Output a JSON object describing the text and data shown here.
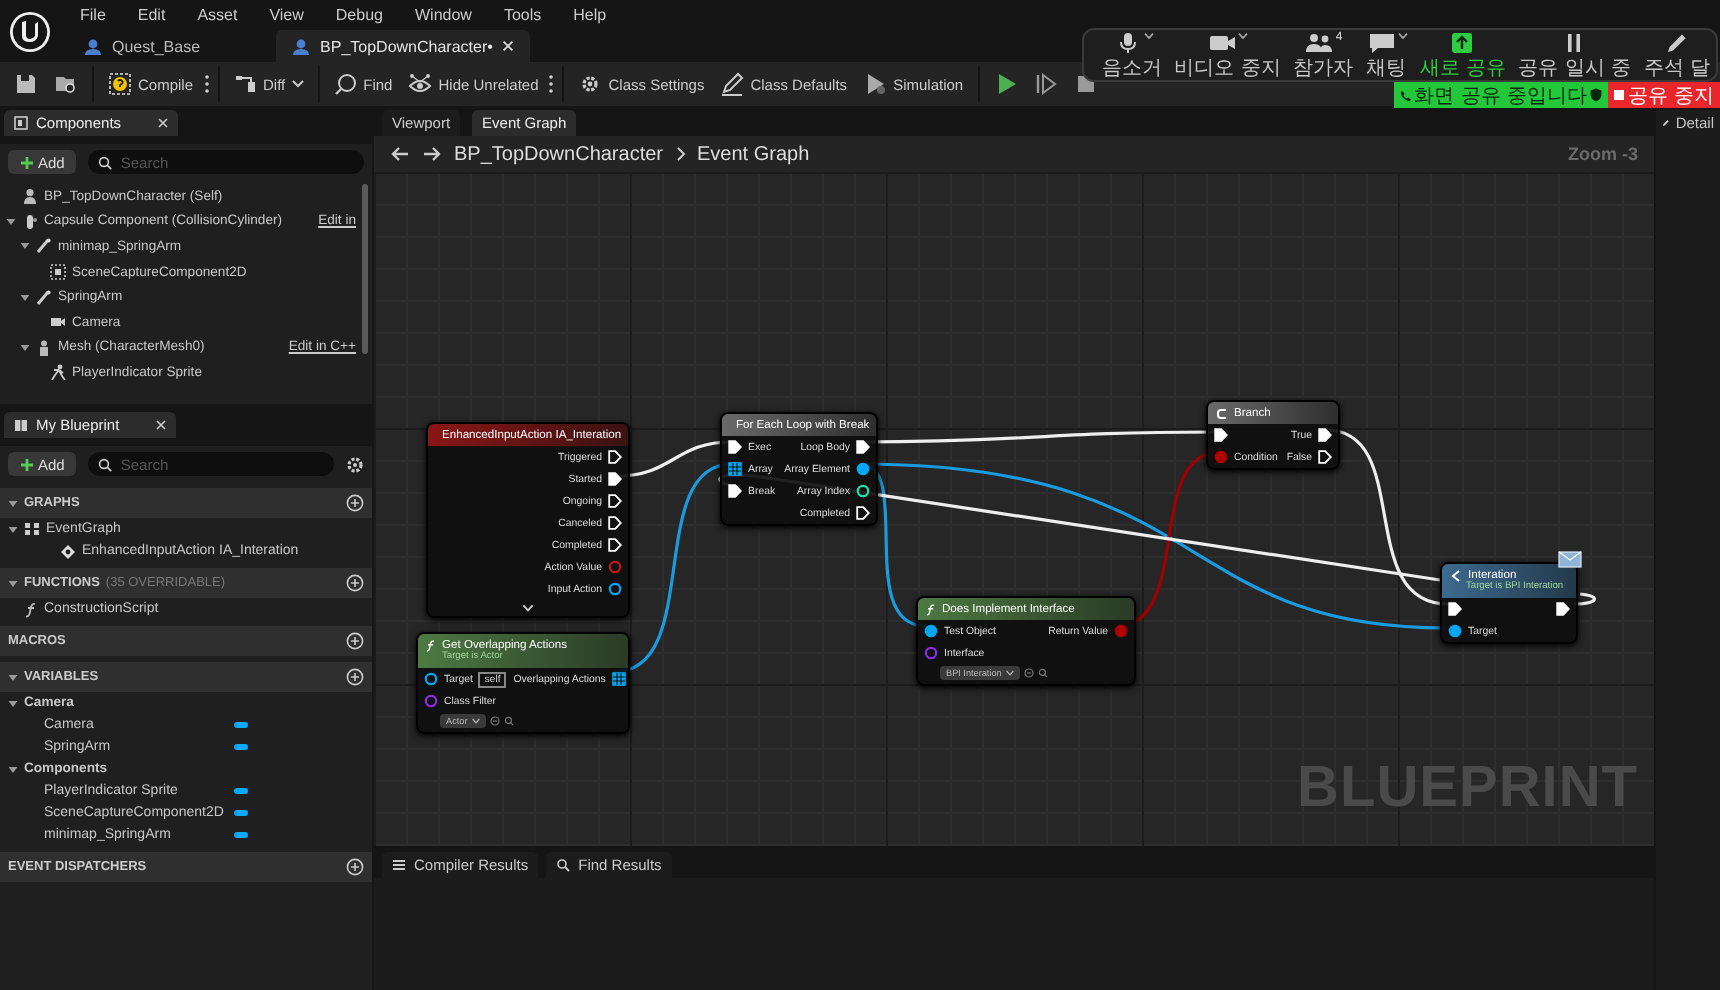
{
  "menu": [
    "File",
    "Edit",
    "Asset",
    "View",
    "Debug",
    "Window",
    "Tools",
    "Help"
  ],
  "document_tabs": [
    {
      "label": "Quest_Base",
      "selected": false
    },
    {
      "label": "BP_TopDownCharacter•",
      "selected": true
    }
  ],
  "toolbar": [
    {
      "kind": "save"
    },
    {
      "kind": "browse"
    },
    {
      "kind": "compile",
      "label": "Compile"
    },
    {
      "kind": "diff",
      "label": "Diff"
    },
    {
      "kind": "find",
      "label": "Find"
    },
    {
      "kind": "hide",
      "label": "Hide Unrelated"
    },
    {
      "kind": "class_settings",
      "label": "Class Settings"
    },
    {
      "kind": "class_defaults",
      "label": "Class Defaults"
    },
    {
      "kind": "simulation",
      "label": "Simulation"
    },
    {
      "kind": "play"
    },
    {
      "kind": "step"
    },
    {
      "kind": "stop"
    }
  ],
  "meeting_controls": [
    {
      "kind": "mic",
      "label": "음소거",
      "menu": true
    },
    {
      "kind": "video",
      "label": "비디오 중지",
      "menu": true
    },
    {
      "kind": "participants",
      "label": "참가자",
      "menu": false,
      "count": "4"
    },
    {
      "kind": "chat",
      "label": "채팅",
      "menu": true
    },
    {
      "kind": "share",
      "label": "새로 공유",
      "menu": false
    },
    {
      "kind": "pause",
      "label": "공유 일시 중",
      "menu": false
    },
    {
      "kind": "annotate",
      "label": "주석 달",
      "menu": false
    }
  ],
  "sharing_banner": {
    "message": "화면 공유 중입니다",
    "stop": "공유 중지"
  },
  "components": {
    "tab": "Components",
    "add": "Add",
    "search_placeholder": "Search",
    "tree": [
      {
        "label": "BP_TopDownCharacter (Self)",
        "kind": "actor"
      },
      {
        "label": "Capsule Component (CollisionCylinder)",
        "kind": "capsule",
        "edit_link": "Edit in",
        "children": [
          {
            "label": "minimap_SpringArm",
            "kind": "spring_arm",
            "children": [
              {
                "label": "SceneCaptureComponent2D",
                "kind": "scene_capture"
              }
            ]
          },
          {
            "label": "SpringArm",
            "kind": "spring_arm",
            "children": [
              {
                "label": "Camera",
                "kind": "camera"
              }
            ]
          },
          {
            "label": "Mesh (CharacterMesh0)",
            "kind": "mesh",
            "edit_link": "Edit in C++",
            "children": [
              {
                "label": "PlayerIndicator Sprite",
                "kind": "sprite"
              }
            ]
          }
        ]
      }
    ]
  },
  "my_blueprint": {
    "tab": "My Blueprint",
    "add": "Add",
    "search_placeholder": "Search",
    "sections": [
      {
        "title": "GRAPHS",
        "items": [
          {
            "label": "EventGraph",
            "kind": "graph",
            "children": [
              {
                "label": "EnhancedInputAction IA_Interation",
                "kind": "event"
              }
            ]
          }
        ]
      },
      {
        "title": "FUNCTIONS",
        "note": "(35 OVERRIDABLE)",
        "items": [
          {
            "label": "ConstructionScript",
            "kind": "function"
          }
        ]
      },
      {
        "title": "MACROS"
      },
      {
        "title": "VARIABLES",
        "items": [
          {
            "label": "Camera",
            "kind": "category",
            "children": [
              {
                "label": "Camera",
                "kind": "variable"
              },
              {
                "label": "SpringArm",
                "kind": "variable"
              }
            ]
          },
          {
            "label": "Components",
            "kind": "category",
            "children": [
              {
                "label": "PlayerIndicator Sprite",
                "kind": "variable"
              },
              {
                "label": "SceneCaptureComponent2D",
                "kind": "variable"
              },
              {
                "label": "minimap_SpringArm",
                "kind": "variable"
              }
            ]
          }
        ]
      },
      {
        "title": "EVENT DISPATCHERS"
      }
    ]
  },
  "graph": {
    "tabs": [
      {
        "label": "Viewport",
        "selected": false
      },
      {
        "label": "Event Graph",
        "selected": true
      }
    ],
    "breadcrumb": [
      "BP_TopDownCharacter",
      "Event Graph"
    ],
    "zoom": "Zoom -3",
    "watermark": "BLUEPRINT",
    "nodes": [
      {
        "kind": "event",
        "title": "EnhancedInputAction IA_Interation",
        "outputs": [
          {
            "label": "Triggered",
            "kind": "exec",
            "connected": false
          },
          {
            "label": "Started",
            "kind": "exec",
            "connected": true
          },
          {
            "label": "Ongoing",
            "kind": "exec",
            "connected": false
          },
          {
            "label": "Canceled",
            "kind": "exec",
            "connected": false
          },
          {
            "label": "Completed",
            "kind": "exec",
            "connected": false
          },
          {
            "label": "Action Value",
            "kind": "struct",
            "connected": false
          },
          {
            "label": "Input Action",
            "kind": "object",
            "connected": false
          }
        ]
      },
      {
        "kind": "function",
        "title": "Get Overlapping Actions",
        "subtitle": "Target is Actor",
        "inputs": [
          {
            "label": "Target",
            "kind": "object",
            "connected": false,
            "value": "self"
          },
          {
            "label": "Class Filter",
            "kind": "class",
            "connected": false,
            "dropdown": "Actor"
          }
        ],
        "outputs": [
          {
            "label": "Overlapping Actions",
            "kind": "array",
            "connected": true
          }
        ]
      },
      {
        "kind": "macro",
        "title": "For Each Loop with Break",
        "inputs": [
          {
            "label": "Exec",
            "kind": "exec",
            "connected": true
          },
          {
            "label": "Array",
            "kind": "array",
            "connected": true
          },
          {
            "label": "Break",
            "kind": "exec",
            "connected": true
          }
        ],
        "outputs": [
          {
            "label": "Loop Body",
            "kind": "exec",
            "connected": true
          },
          {
            "label": "Array Element",
            "kind": "object",
            "connected": true
          },
          {
            "label": "Array Index",
            "kind": "int",
            "connected": false
          },
          {
            "label": "Completed",
            "kind": "exec",
            "connected": false
          }
        ]
      },
      {
        "kind": "branch",
        "title": "Branch",
        "inputs": [
          {
            "kind": "exec",
            "connected": true
          },
          {
            "label": "Condition",
            "kind": "bool",
            "connected": true
          }
        ],
        "outputs": [
          {
            "label": "True",
            "kind": "exec",
            "connected": true
          },
          {
            "label": "False",
            "kind": "exec",
            "connected": false
          }
        ]
      },
      {
        "kind": "function",
        "title": "Does Implement Interface",
        "inputs": [
          {
            "label": "Test Object",
            "kind": "object",
            "connected": true
          },
          {
            "label": "Interface",
            "kind": "class",
            "connected": false,
            "dropdown": "BPI Interation"
          }
        ],
        "outputs": [
          {
            "label": "Return Value",
            "kind": "bool",
            "connected": true
          }
        ]
      },
      {
        "kind": "message",
        "title": "Interation",
        "subtitle": "Target is BPI Interation",
        "inputs": [
          {
            "kind": "exec",
            "connected": true
          },
          {
            "label": "Target",
            "kind": "object",
            "connected": true
          }
        ],
        "outputs": [
          {
            "kind": "exec",
            "connected": true
          }
        ]
      }
    ]
  },
  "bottom_tabs": [
    {
      "label": "Compiler Results",
      "selected": false
    },
    {
      "label": "Find Results",
      "selected": false
    }
  ],
  "details_tab": "Detail"
}
